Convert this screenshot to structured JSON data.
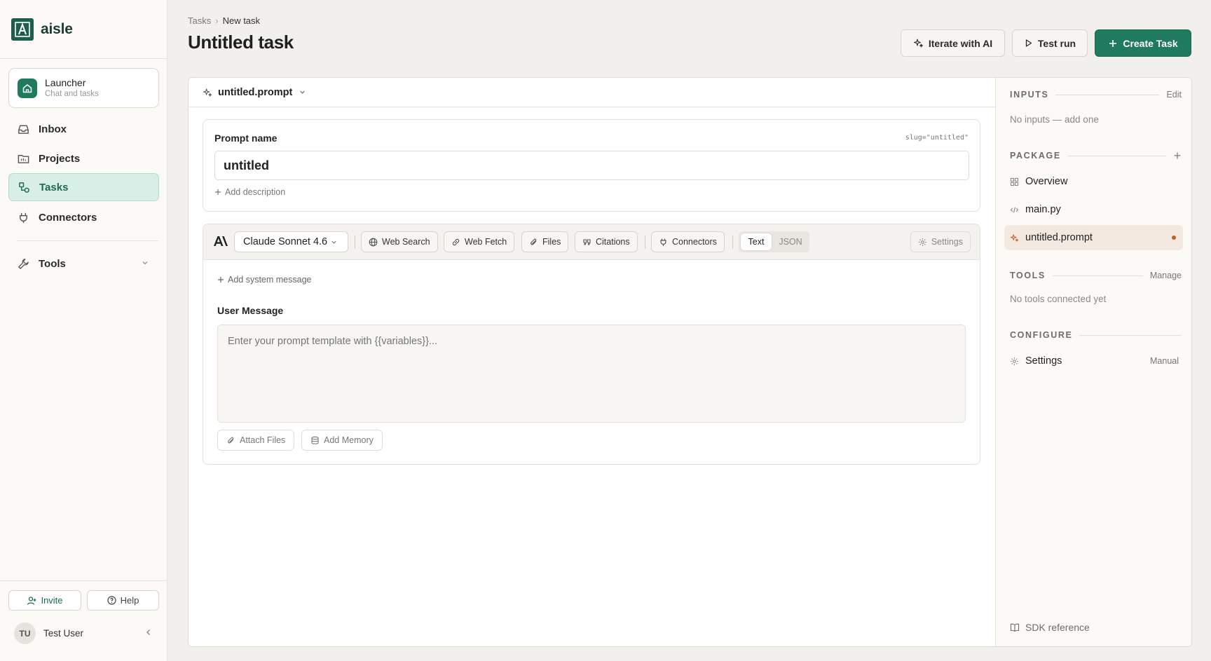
{
  "app": {
    "name": "aisle"
  },
  "sidebar": {
    "launcher": {
      "title": "Launcher",
      "subtitle": "Chat and tasks"
    },
    "nav": [
      {
        "label": "Inbox",
        "icon": "inbox-icon"
      },
      {
        "label": "Projects",
        "icon": "projects-icon"
      },
      {
        "label": "Tasks",
        "icon": "tasks-icon",
        "active": true
      },
      {
        "label": "Connectors",
        "icon": "plug-icon"
      }
    ],
    "tools_label": "Tools",
    "invite_label": "Invite",
    "help_label": "Help",
    "user": {
      "initials": "TU",
      "name": "Test User"
    }
  },
  "header": {
    "breadcrumb": [
      "Tasks",
      "New task"
    ],
    "title": "Untitled task",
    "iterate_label": "Iterate with AI",
    "test_run_label": "Test run",
    "create_label": "Create Task"
  },
  "editor": {
    "file_name": "untitled.prompt",
    "prompt_name_label": "Prompt name",
    "slug": "slug=\"untitled\"",
    "prompt_name_value": "untitled",
    "add_description": "Add description",
    "model": "Claude Sonnet 4.6",
    "tools": {
      "web_search": "Web Search",
      "web_fetch": "Web Fetch",
      "files": "Files",
      "citations": "Citations",
      "connectors": "Connectors"
    },
    "format": {
      "text": "Text",
      "json": "JSON",
      "selected": "Text"
    },
    "settings_label": "Settings",
    "add_system_message": "Add system message",
    "user_message_label": "User Message",
    "prompt_placeholder": "Enter your prompt template with {{variables}}...",
    "attach_files": "Attach Files",
    "add_memory": "Add Memory"
  },
  "right_panel": {
    "inputs": {
      "title": "INPUTS",
      "action": "Edit",
      "empty": "No inputs — add one"
    },
    "package": {
      "title": "PACKAGE",
      "items": [
        {
          "label": "Overview",
          "icon": "grid-icon"
        },
        {
          "label": "main.py",
          "icon": "code-icon"
        },
        {
          "label": "untitled.prompt",
          "icon": "sparkle-icon",
          "active": true,
          "modified": true
        }
      ]
    },
    "tools": {
      "title": "TOOLS",
      "action": "Manage",
      "empty": "No tools connected yet"
    },
    "configure": {
      "title": "CONFIGURE",
      "settings_label": "Settings",
      "settings_value": "Manual"
    },
    "sdk_reference": "SDK reference"
  },
  "colors": {
    "brand": "#1f5e4c",
    "accent": "#1f7a5e",
    "active_nav_bg": "#d8efe7",
    "modified_dot": "#c85d2a"
  }
}
